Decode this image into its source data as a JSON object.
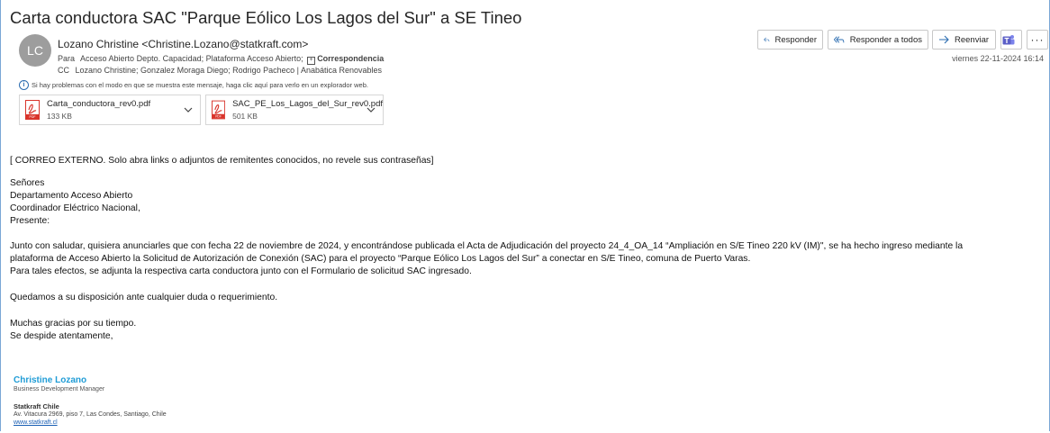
{
  "email": {
    "subject": "Carta conductora SAC \"Parque Eólico Los Lagos del Sur\" a SE Tineo",
    "avatar_initials": "LC",
    "from": "Lozano Christine <Christine.Lozano@statkraft.com>",
    "to_label": "Para",
    "to": "Acceso Abierto Depto. Capacidad; Plataforma Acceso Abierto;",
    "to_group": "Correspondencia",
    "cc_label": "CC",
    "cc": "Lozano Christine; Gonzalez Moraga Diego; Rodrigo  Pacheco | Anabática Renovables",
    "info": "Si hay problemas con el modo en que se muestra este mensaje, haga clic aquí para verlo en un explorador web.",
    "date": "viernes 22-11-2024 16:14"
  },
  "toolbar": {
    "reply": "Responder",
    "reply_all": "Responder a todos",
    "forward": "Reenviar",
    "more": "···"
  },
  "attachments": [
    {
      "name": "Carta_conductora_rev0.pdf",
      "size": "133 KB"
    },
    {
      "name": "SAC_PE_Los_Lagos_del_Sur_rev0.pdf",
      "size": "501 KB"
    }
  ],
  "body": {
    "external_notice": "[ CORREO EXTERNO. Solo abra links o adjuntos de remitentes conocidos, no revele sus contraseñas]",
    "greeting": [
      "Señores",
      "Departamento Acceso Abierto",
      "Coordinador Eléctrico Nacional,",
      "Presente:"
    ],
    "paragraph1": [
      "Junto con saludar, quisiera anunciarles que con fecha 22 de noviembre de 2024, y encontrándose publicada el Acta de Adjudicación del proyecto 24_4_OA_14 “Ampliación en S/E Tineo 220 kV (IM)\", se ha hecho ingreso mediante la",
      "plataforma de Acceso Abierto la Solicitud de Autorización de Conexión (SAC) para el proyecto “Parque Eólico Los Lagos del Sur” a conectar en S/E Tineo, comuna de Puerto Varas.",
      "Para tales efectos, se adjunta la respectiva carta conductora junto con el Formulario de solicitud SAC ingresado."
    ],
    "paragraph2": "Quedamos a su disposición ante cualquier duda o requerimiento.",
    "closing": [
      "Muchas gracias por su tiempo.",
      "Se despide atentamente,"
    ]
  },
  "signature": {
    "name": "Christine Lozano",
    "role": "Business Development Manager",
    "company": "Statkraft Chile",
    "address": "Av. Vitacura 2969, piso 7, Las Condes, Santiago, Chile",
    "website": "www.statkraft.cl"
  },
  "colors": {
    "accent_blue": "#2b6cb0",
    "signature_name": "#1f9cd6",
    "pdf_red": "#d9342b",
    "teams_purple": "#5b5fc7"
  }
}
